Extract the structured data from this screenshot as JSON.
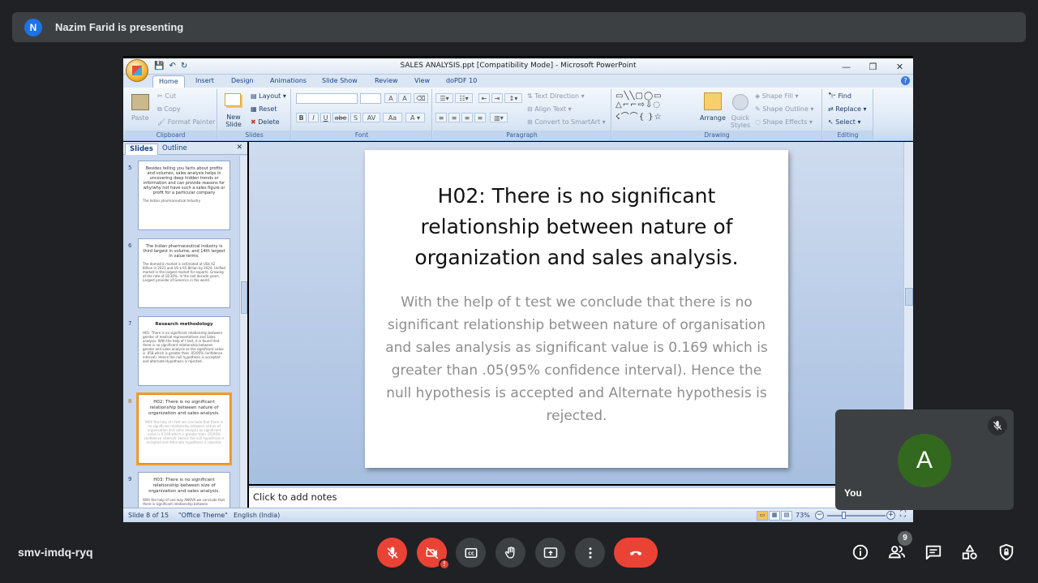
{
  "meet": {
    "presenter_initial": "N",
    "presenter_text": "Nazim Farid is presenting",
    "meeting_code": "smv-imdq-ryq",
    "self_initial": "A",
    "self_name": "You",
    "people_count": "9",
    "colors": {
      "background": "#202124",
      "tile": "#3c4043",
      "red": "#ea4335",
      "self_avatar": "#33691e",
      "presenter_avatar": "#1a73e8"
    },
    "controls": [
      "mic-off-icon",
      "camera-off-icon",
      "closed-captions-icon",
      "raise-hand-icon",
      "present-screen-icon",
      "more-options-icon",
      "end-call-icon"
    ],
    "side_controls": [
      "info-icon",
      "people-icon",
      "chat-icon",
      "activities-icon",
      "host-controls-icon"
    ]
  },
  "ppt": {
    "window_title": "SALES ANALYSIS.ppt [Compatibility Mode] - Microsoft PowerPoint",
    "tabs": [
      "Home",
      "Insert",
      "Design",
      "Animations",
      "Slide Show",
      "Review",
      "View",
      "doPDF 10"
    ],
    "active_tab": "Home",
    "ribbon": {
      "clipboard": {
        "label": "Clipboard",
        "paste": "Paste",
        "cut": "Cut",
        "copy": "Copy",
        "format_painter": "Format Painter"
      },
      "slides": {
        "label": "Slides",
        "new_slide": "New Slide",
        "layout": "Layout",
        "reset": "Reset",
        "delete": "Delete"
      },
      "font": {
        "label": "Font",
        "bold": "B",
        "italic": "I",
        "underline": "U",
        "strike": "abe",
        "shadow": "S",
        "spacing": "AV",
        "case": "Aa",
        "grow": "A",
        "shrink": "A"
      },
      "paragraph": {
        "label": "Paragraph",
        "text_direction": "Text Direction",
        "align_text": "Align Text",
        "convert_smartart": "Convert to SmartArt"
      },
      "drawing": {
        "label": "Drawing",
        "arrange": "Arrange",
        "quick_styles": "Quick Styles",
        "shape_fill": "Shape Fill",
        "shape_outline": "Shape Outline",
        "shape_effects": "Shape Effects"
      },
      "editing": {
        "label": "Editing",
        "find": "Find",
        "replace": "Replace",
        "select": "Select"
      }
    },
    "panel_tabs": [
      "Slides",
      "Outline"
    ],
    "thumbnails": [
      {
        "num": "5",
        "title": "Besides telling you facts about profits and volumes, sales analysis helps in uncovering deep hidden trends or information and can provide reasons for why/why not have such a sales figure or profit for a particular company",
        "body": "The Indian pharmaceutical Industry",
        "grey": ""
      },
      {
        "num": "6",
        "title": "The Indian pharmaceutical industry is third largest in volume, and 14th largest in value terms.",
        "body": "The domestic market is estimated at US$ 42 Billion in 2021 and US $ 65 Billion by 2024. Unified market in the largest market for exports. Growing at the rate of 18.10%. In the last decade years. Largest provider of Generics in the world.",
        "grey": ""
      },
      {
        "num": "7",
        "title": "Research methodology",
        "body": "H01: There is no significant relationship between gender of medical representatives and Sales analysis. With the help of t test, it is found that there is no significant relationship between gender and sales analysis as the significant value is .058 which is greater than .05(95% confidence interval). Hence the null hypothesis is accepted and alternate Hypothesis is rejected.",
        "grey": ""
      },
      {
        "num": "8",
        "title": "H02: There is no significant relationship between nature of organization and sales analysis.",
        "body": "",
        "grey": "With the help of t test we conclude that there is no significant relationship between nature of organisation and sales analysis as significant value is 0.169 which is greater than .05(95% confidence interval). Hence the null hypothesis is accepted and Alternate hypothesis is rejected."
      },
      {
        "num": "9",
        "title": "H03: There is no significant relationship between size of organization and sales analysis.",
        "body": "With the help of one way ANOVA we conclude that there is significant relationship between",
        "grey": ""
      }
    ],
    "slide": {
      "title": "H02:  There is no significant relationship between nature of organization and sales analysis.",
      "body": "With the help of t test we conclude that there is no significant relationship between nature of organisation and sales analysis as significant value is 0.169 which is greater than .05(95% confidence interval). Hence the null hypothesis is accepted and Alternate hypothesis is rejected."
    },
    "notes_placeholder": "Click to add notes",
    "status": {
      "slide": "Slide 8 of 15",
      "theme": "\"Office Theme\"",
      "language": "English (India)",
      "zoom": "73%"
    }
  }
}
